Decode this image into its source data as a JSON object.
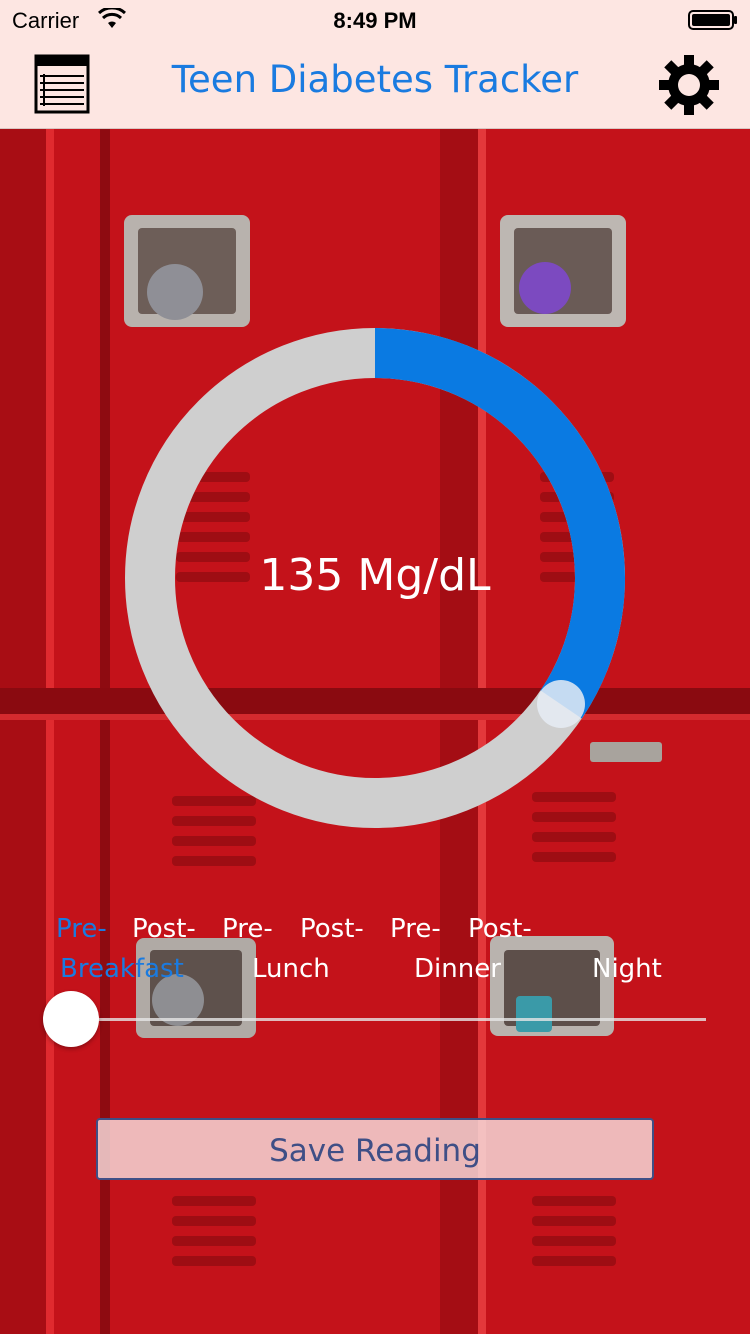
{
  "status_bar": {
    "carrier": "Carrier",
    "time": "8:49 PM",
    "wifi_icon": "wifi-icon",
    "battery_icon": "battery-icon"
  },
  "nav": {
    "title": "Teen Diabetes Tracker",
    "left_icon": "list-icon",
    "right_icon": "gear-icon"
  },
  "gauge": {
    "reading_text": "135 Mg/dL",
    "fill_fraction": 0.345,
    "fill_color": "#0a7ae2",
    "track_color": "#cfcfcf"
  },
  "meal_times": [
    {
      "line1": "Pre-",
      "line2": "Breakfast",
      "active": true
    },
    {
      "line1": "Post-",
      "line2": "",
      "active": false
    },
    {
      "line1": "Pre-",
      "line2": "Lunch",
      "active": false
    },
    {
      "line1": "Post-",
      "line2": "",
      "active": false
    },
    {
      "line1": "Pre-",
      "line2": "Dinner",
      "active": false
    },
    {
      "line1": "Post-",
      "line2": "",
      "active": false
    },
    {
      "line1": "",
      "line2": "Night",
      "active": false
    }
  ],
  "slider": {
    "value_fraction": 0.0
  },
  "save_button": {
    "label": "Save Reading"
  },
  "colors": {
    "accent": "#1a7be0",
    "nav_background": "#fde6e2",
    "background": "#c7141b"
  }
}
